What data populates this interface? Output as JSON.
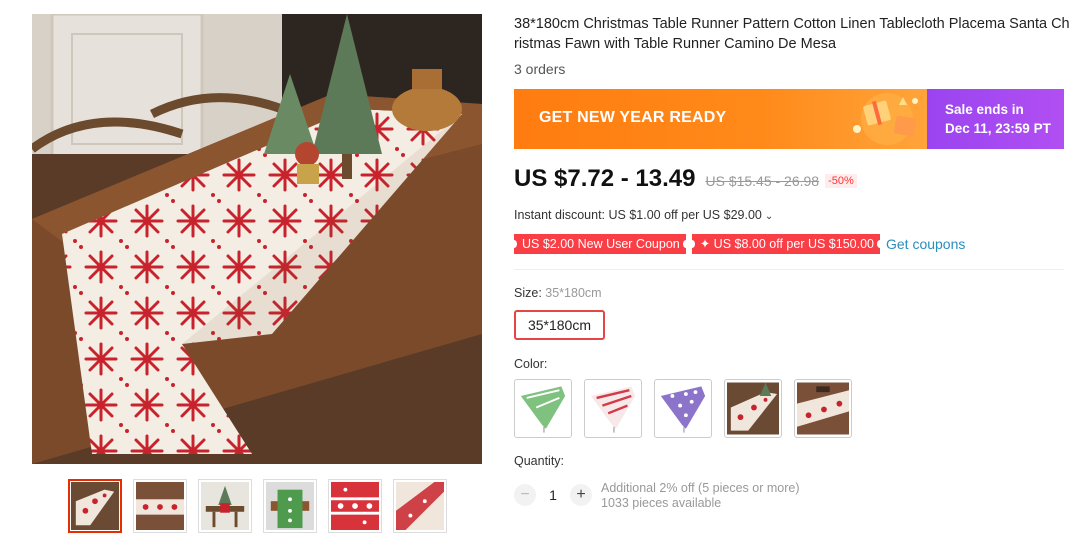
{
  "product": {
    "title": "38*180cm Christmas Table Runner Pattern Cotton Linen Tablecloth Placema Santa Christmas Fawn with Table Runner Camino De Mesa",
    "orders": "3 orders"
  },
  "banner": {
    "promo_text": "GET NEW YEAR READY",
    "sale_line1": "Sale ends in",
    "sale_line2": "Dec 11, 23:59 PT"
  },
  "price": {
    "current": "US $7.72 - 13.49",
    "original": "US $15.45 - 26.98",
    "discount": "-50%"
  },
  "instant_discount": {
    "text": "Instant discount: US $1.00 off per US $29.00",
    "chevron": "chevron-down-icon"
  },
  "coupons": {
    "items": [
      "US $2.00 New User Coupon",
      "✦ US $8.00 off per US $150.00"
    ],
    "get_link": "Get coupons"
  },
  "size": {
    "label": "Size:",
    "selected": "35*180cm",
    "options": [
      "35*180cm"
    ]
  },
  "color": {
    "label": "Color:",
    "options": [
      "green-stripe",
      "red-stripe",
      "purple-snowflake",
      "red-snowflake-photo",
      "red-snowflake-photo-2"
    ]
  },
  "quantity": {
    "label": "Quantity:",
    "value": "1",
    "minus": "−",
    "plus": "+",
    "info_line1": "Additional 2% off (5 pieces or more)",
    "info_line2": "1033 pieces available"
  },
  "gallery": {
    "thumbnails": [
      "thumb-1",
      "thumb-2",
      "thumb-3",
      "thumb-4",
      "thumb-5",
      "thumb-6"
    ]
  },
  "colors": {
    "accent_red": "#e62e04",
    "banner_orange": "#ff7c10",
    "banner_purple": "#9a44f0",
    "coupon_red": "#fa3e46",
    "link_blue": "#2a8fbd"
  }
}
